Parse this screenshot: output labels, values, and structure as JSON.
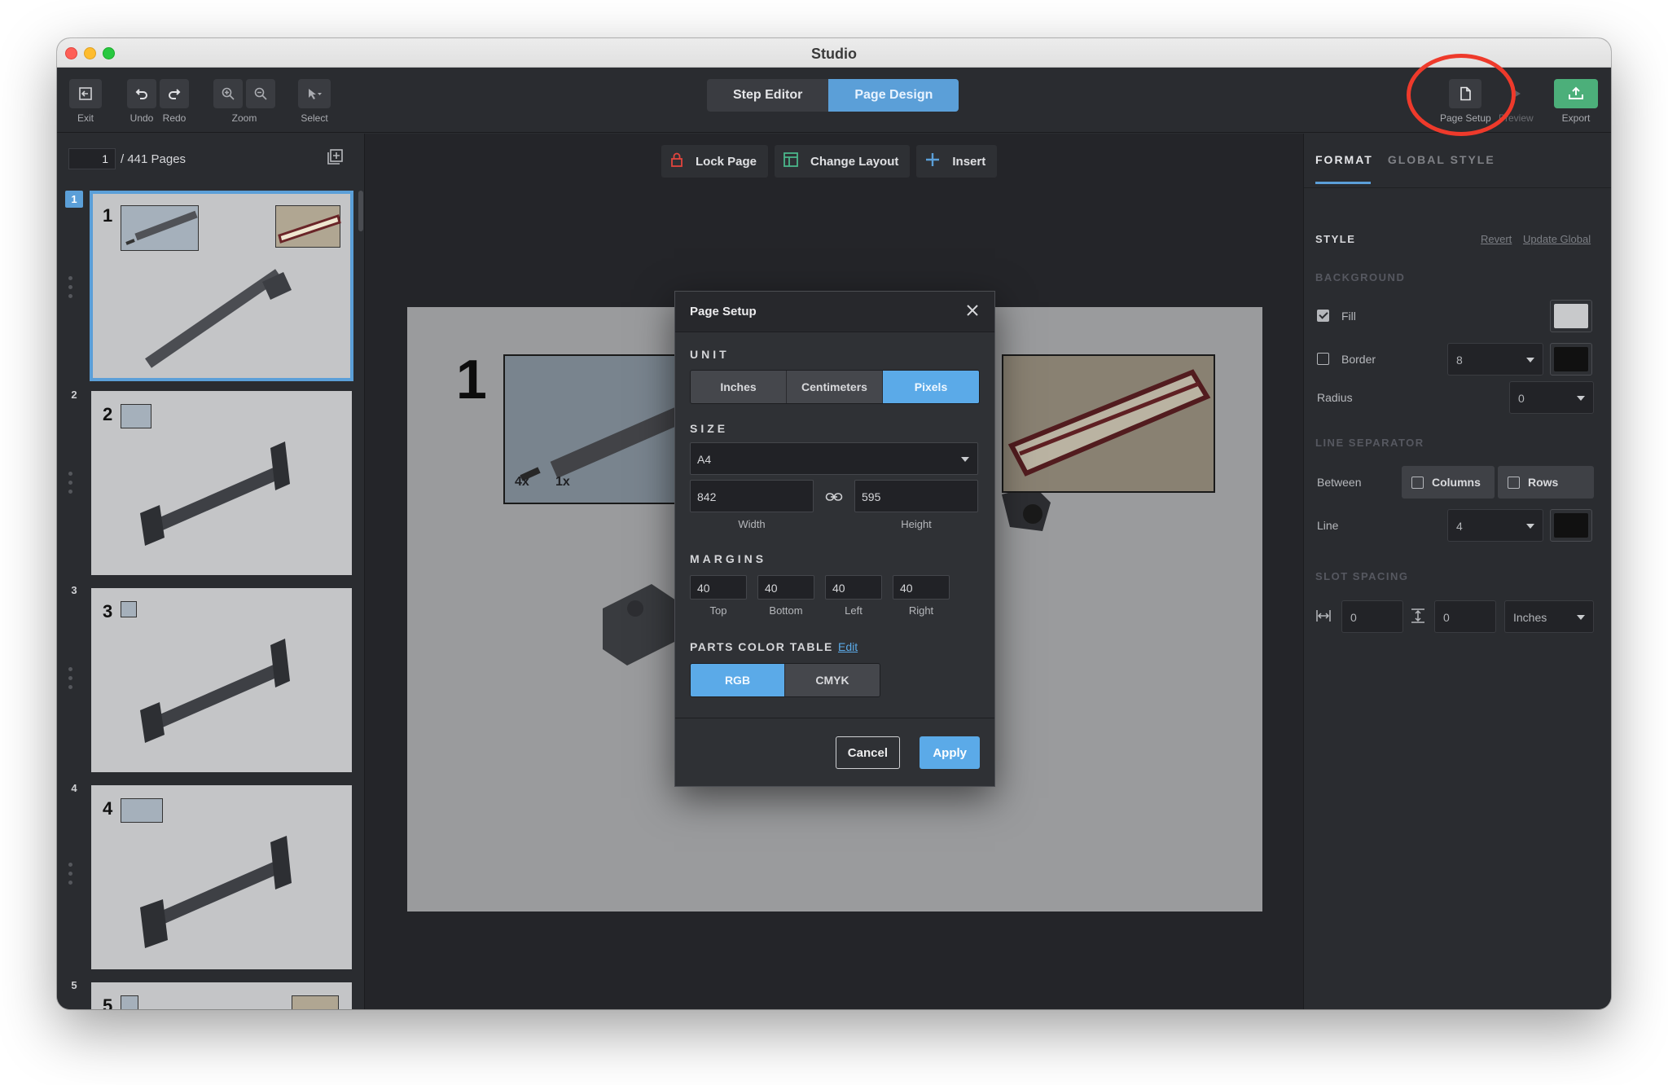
{
  "window": {
    "title": "Studio"
  },
  "toolbar": {
    "exit": "Exit",
    "undo": "Undo",
    "redo": "Redo",
    "zoom": "Zoom",
    "select": "Select",
    "step_editor": "Step Editor",
    "page_design": "Page Design",
    "page_setup": "Page Setup",
    "preview": "Preview",
    "export": "Export"
  },
  "pages": {
    "current": "1",
    "total_label": "/ 441 Pages",
    "thumbs": [
      {
        "num": "1"
      },
      {
        "num": "2"
      },
      {
        "num": "3"
      },
      {
        "num": "4"
      },
      {
        "num": "5"
      }
    ]
  },
  "canvas_bar": {
    "lock": "Lock Page",
    "change_layout": "Change Layout",
    "insert": "Insert"
  },
  "canvas": {
    "step_number": "1",
    "callout_counts": [
      "4x",
      "1x"
    ]
  },
  "dialog": {
    "title": "Page Setup",
    "unit_label": "UNIT",
    "units": [
      "Inches",
      "Centimeters",
      "Pixels"
    ],
    "size_label": "SIZE",
    "size_value": "A4",
    "width": "842",
    "height": "595",
    "width_label": "Width",
    "height_label": "Height",
    "margins_label": "MARGINS",
    "margins": [
      {
        "value": "40",
        "label": "Top"
      },
      {
        "value": "40",
        "label": "Bottom"
      },
      {
        "value": "40",
        "label": "Left"
      },
      {
        "value": "40",
        "label": "Right"
      }
    ],
    "parts_label": "PARTS COLOR TABLE",
    "edit": "Edit",
    "color_modes": [
      "RGB",
      "CMYK"
    ],
    "cancel": "Cancel",
    "apply": "Apply"
  },
  "right": {
    "tab_format": "FORMAT",
    "tab_global": "GLOBAL STYLE",
    "style": "STYLE",
    "revert": "Revert",
    "update_global": "Update Global",
    "background": "BACKGROUND",
    "fill": "Fill",
    "border": "Border",
    "border_value": "8",
    "radius": "Radius",
    "radius_value": "0",
    "line_separator": "LINE SEPARATOR",
    "between": "Between",
    "columns": "Columns",
    "rows": "Rows",
    "line": "Line",
    "line_value": "4",
    "slot_spacing": "SLOT SPACING",
    "spacing_h": "0",
    "spacing_v": "0",
    "spacing_unit": "Inches"
  },
  "colors": {
    "accent": "#5baae8",
    "fill_swatch": "#c8c9cb",
    "border_swatch": "#111111",
    "line_swatch": "#111111",
    "annotation": "#ee3a2b"
  }
}
